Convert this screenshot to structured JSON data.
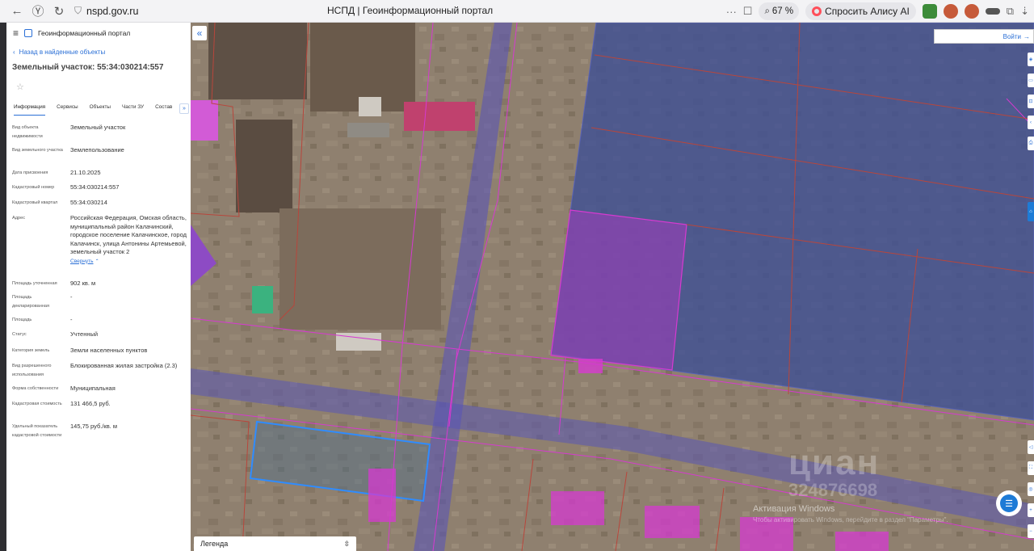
{
  "browser": {
    "url": "nspd.gov.ru",
    "tab_title": "НСПД | Геоинформационный портал",
    "zoom": "67 %",
    "ask_alice": "Спросить Алису AI"
  },
  "panel": {
    "portal_name": "Геоинформационный портал",
    "back_link": "Назад в найденные объекты",
    "object_title": "Земельный участок: 55:34:030214:557",
    "tabs": [
      "Информация",
      "Сервисы",
      "Объекты",
      "Части ЗУ",
      "Состав"
    ],
    "more_tabs": "»",
    "rows": [
      {
        "label": "Вид объекта недвижимости",
        "value": "Земельный участок"
      },
      {
        "label": "Вид земельного участка",
        "value": "Землепользование"
      },
      {
        "label": "Дата присвоения",
        "value": "21.10.2025"
      },
      {
        "label": "Кадастровый номер",
        "value": "55:34:030214:557"
      },
      {
        "label": "Кадастровый квартал",
        "value": "55:34:030214"
      },
      {
        "label": "Адрес",
        "value": "Российская Федерация, Омская область, муниципальный район Калачинский, городское поселение Калачинское, город Калачинск, улица Антонины Артемьевой, земельный участок 2"
      },
      {
        "label": "Площадь уточненная",
        "value": "902 кв. м"
      },
      {
        "label": "Площадь декларированная",
        "value": "-"
      },
      {
        "label": "Площадь",
        "value": "-"
      },
      {
        "label": "Статус",
        "value": "Учтенный"
      },
      {
        "label": "Категория земель",
        "value": "Земли населенных пунктов"
      },
      {
        "label": "Вид разрешенного использования",
        "value": "Блокированная жилая застройка (2.3)"
      },
      {
        "label": "Форма собственности",
        "value": "Муниципальная"
      },
      {
        "label": "Кадастровая стоимость",
        "value": "131 466,5 руб."
      },
      {
        "label": "Удельный показатель кадастровой стоимости",
        "value": "145,75 руб./кв. м"
      }
    ],
    "collapse_label": "Свернуть"
  },
  "map": {
    "login_label": "Войти",
    "legend_label": "Легенда",
    "watermark_cian": "циан",
    "watermark_id": "324876698",
    "activation_title": "Активация Windows",
    "activation_sub": "Чтобы активировать Windows, перейдите в раздел \"Параметры\"."
  },
  "colors": {
    "accent": "#2a6fd6",
    "parcel_blue": "#3a4f9e",
    "parcel_magenta": "#d63ad0",
    "selected_parcel": "#2f8cff"
  }
}
